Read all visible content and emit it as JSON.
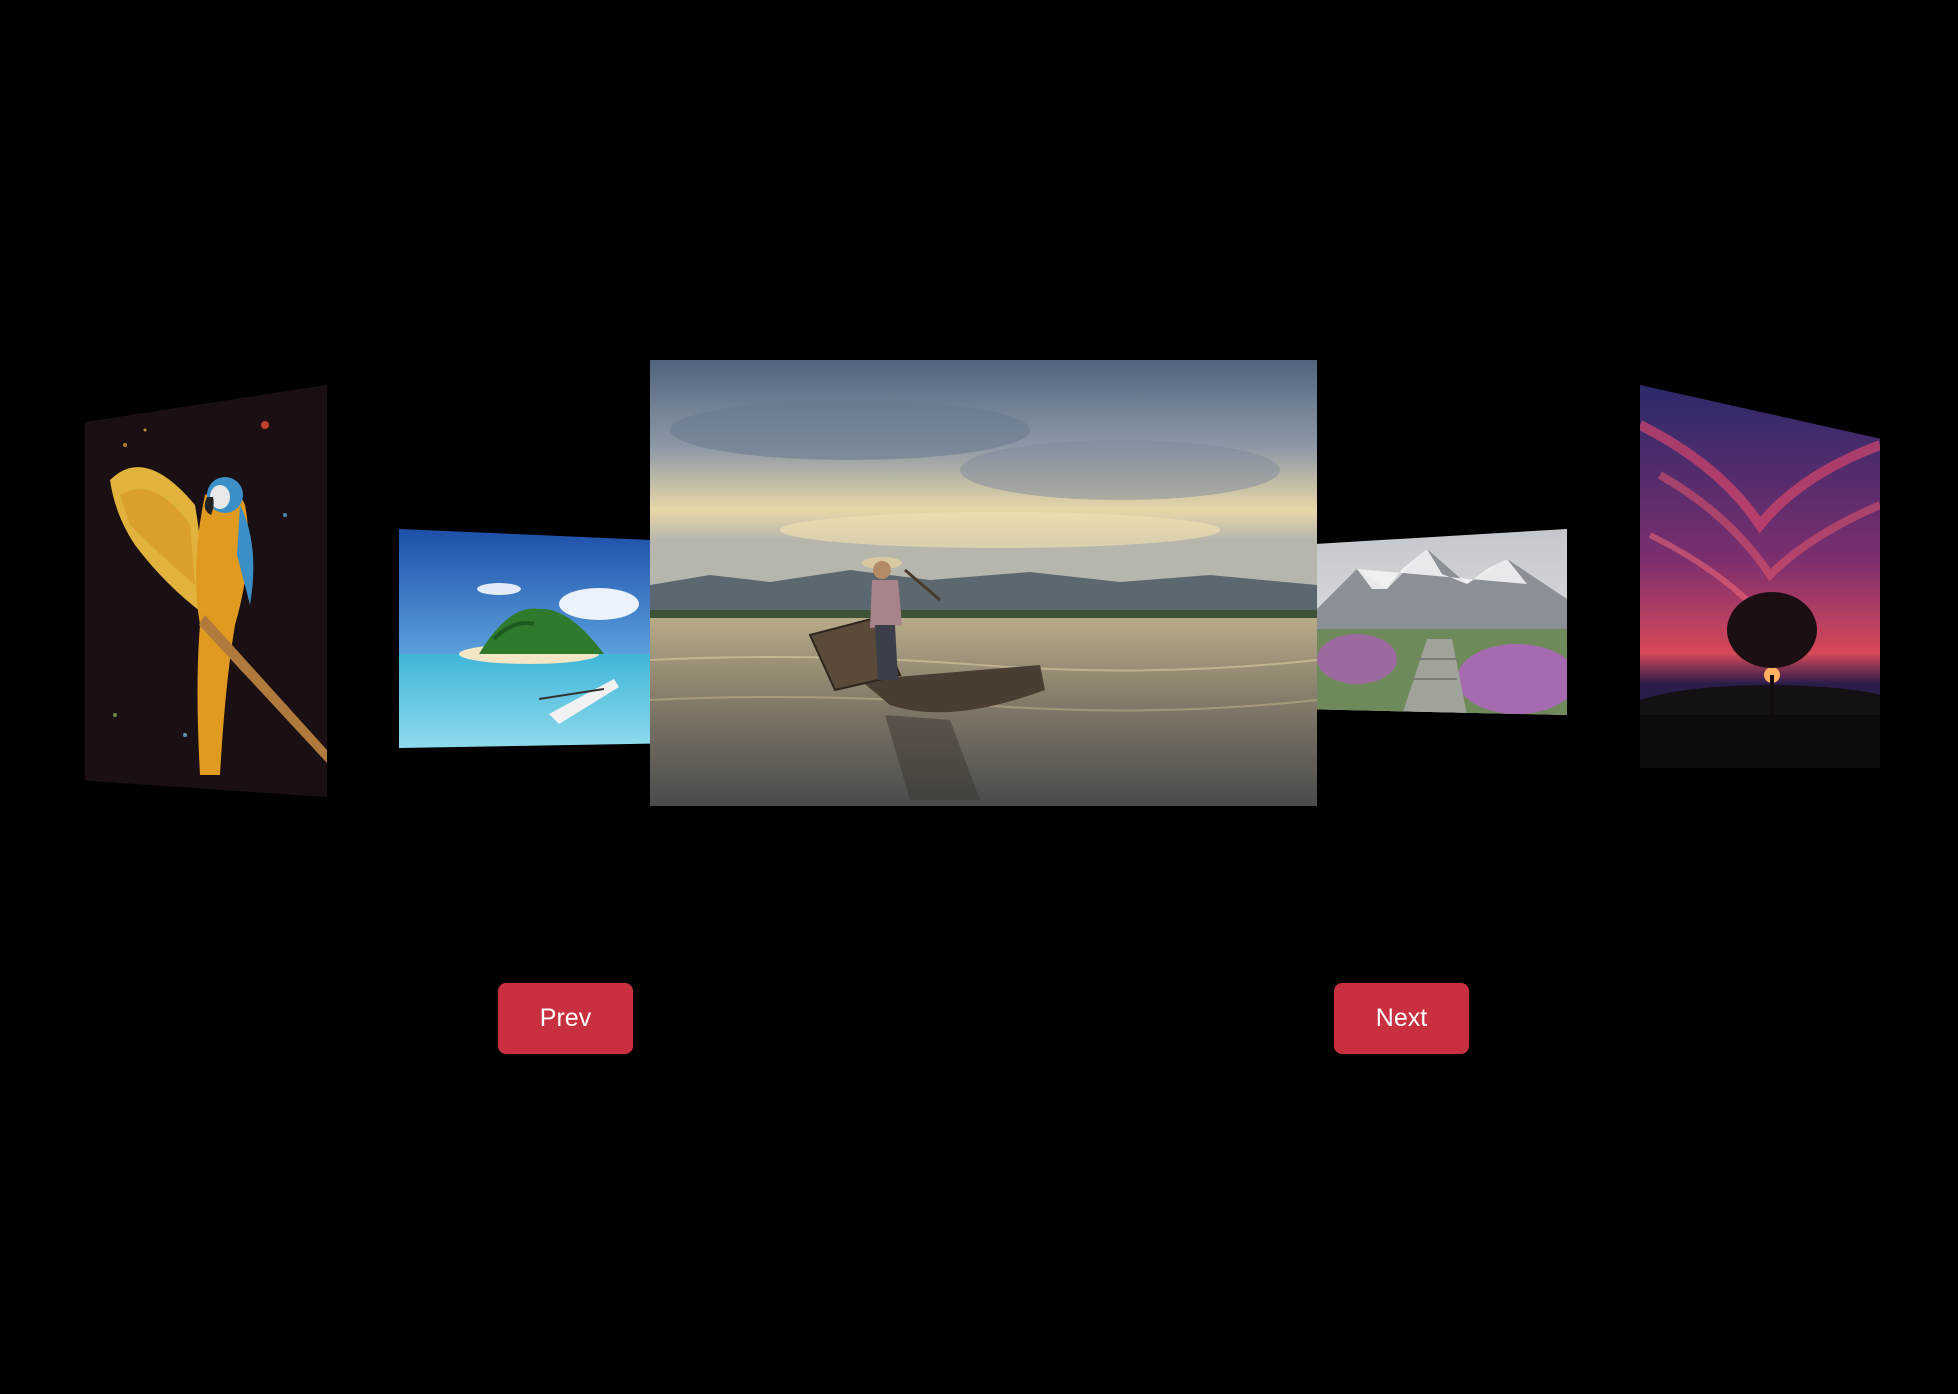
{
  "colors": {
    "background": "#000000",
    "button_bg": "#c8303f",
    "button_text": "#ffffff"
  },
  "carousel": {
    "slides": [
      {
        "subject": "macaw-parrot",
        "position": "far-left"
      },
      {
        "subject": "tropical-island",
        "position": "near-left"
      },
      {
        "subject": "fisherman-boat",
        "position": "center"
      },
      {
        "subject": "mountain-path",
        "position": "near-right"
      },
      {
        "subject": "tree-sunset",
        "position": "far-right"
      }
    ]
  },
  "controls": {
    "prev_label": "Prev",
    "next_label": "Next"
  }
}
